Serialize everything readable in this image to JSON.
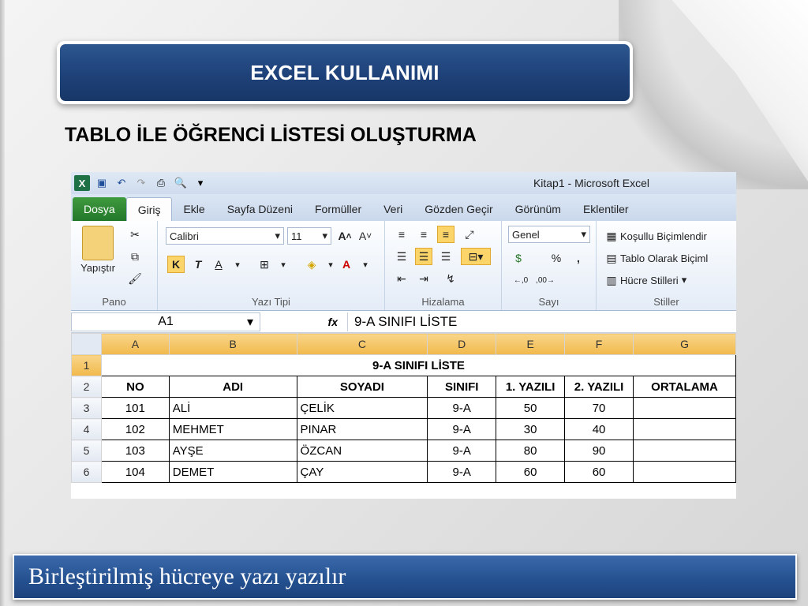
{
  "slide": {
    "title": "EXCEL KULLANIMI",
    "subtitle": "TABLO İLE ÖĞRENCİ LİSTESİ OLUŞTURMA",
    "caption": "Birleştirilmiş hücreye yazı yazılır"
  },
  "excel": {
    "window_title": "Kitap1  -  Microsoft Excel",
    "tabs": [
      "Dosya",
      "Giriş",
      "Ekle",
      "Sayfa Düzeni",
      "Formüller",
      "Veri",
      "Gözden Geçir",
      "Görünüm",
      "Eklentiler"
    ],
    "active_tab": "Giriş",
    "ribbon": {
      "paste_label": "Yapıştır",
      "font_name": "Calibri",
      "font_size": "11",
      "number_format": "Genel",
      "conditional": "Koşullu Biçimlendir",
      "format_table": "Tablo Olarak Biçiml",
      "cell_styles": "Hücre Stilleri",
      "groups": [
        "Pano",
        "Yazı Tipi",
        "Hizalama",
        "Sayı",
        "Stiller"
      ]
    },
    "name_box": "A1",
    "fx": "fx",
    "formula": "9-A SINIFI LİSTE",
    "columns": [
      "A",
      "B",
      "C",
      "D",
      "E",
      "F",
      "G"
    ],
    "merged_title": "9-A SINIFI LİSTE",
    "headers": [
      "NO",
      "ADI",
      "SOYADI",
      "SINIFI",
      "1. YAZILI",
      "2. YAZILI",
      "ORTALAMA"
    ],
    "rows": [
      {
        "row": "3",
        "cells": [
          "101",
          "ALİ",
          "ÇELİK",
          "9-A",
          "50",
          "70",
          ""
        ]
      },
      {
        "row": "4",
        "cells": [
          "102",
          "MEHMET",
          "PINAR",
          "9-A",
          "30",
          "40",
          ""
        ]
      },
      {
        "row": "5",
        "cells": [
          "103",
          "AYŞE",
          "ÖZCAN",
          "9-A",
          "80",
          "90",
          ""
        ]
      },
      {
        "row": "6",
        "cells": [
          "104",
          "DEMET",
          "ÇAY",
          "9-A",
          "60",
          "60",
          ""
        ]
      }
    ],
    "row_numbers": [
      "1",
      "2"
    ]
  }
}
